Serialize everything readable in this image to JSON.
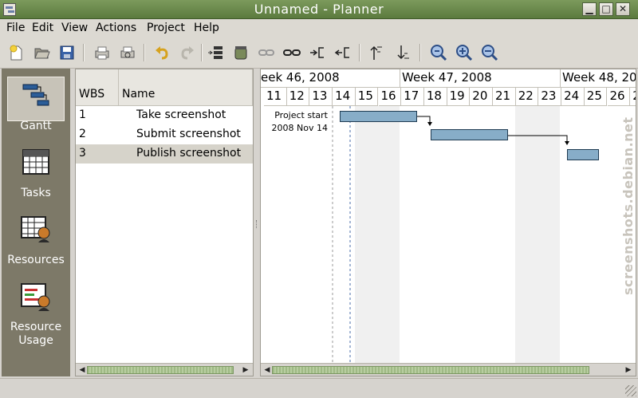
{
  "window": {
    "title": "Unnamed - Planner"
  },
  "menu": [
    "File",
    "Edit",
    "View",
    "Actions",
    "Project",
    "Help"
  ],
  "views": [
    {
      "label": "Gantt",
      "icon": "gantt-icon",
      "active": true
    },
    {
      "label": "Tasks",
      "icon": "tasks-icon"
    },
    {
      "label": "Resources",
      "icon": "resources-icon"
    },
    {
      "label_line1": "Resource",
      "label_line2": "Usage",
      "icon": "resource-usage-icon"
    }
  ],
  "table": {
    "headers": {
      "wbs": "WBS",
      "name": "Name"
    },
    "rows": [
      {
        "wbs": "1",
        "name": "Take screenshot"
      },
      {
        "wbs": "2",
        "name": "Submit screenshot"
      },
      {
        "wbs": "3",
        "name": "Publish screenshot",
        "selected": true
      }
    ]
  },
  "gantt": {
    "weeks": [
      "eek 46, 2008",
      "Week 47, 2008",
      "Week 48, 20"
    ],
    "days": [
      "11",
      "12",
      "13",
      "14",
      "15",
      "16",
      "17",
      "18",
      "19",
      "20",
      "21",
      "22",
      "23",
      "24",
      "25",
      "26",
      "2"
    ],
    "project_start_line1": "Project start",
    "project_start_line2": "2008 Nov 14"
  },
  "watermark": "screenshots.debian.net"
}
